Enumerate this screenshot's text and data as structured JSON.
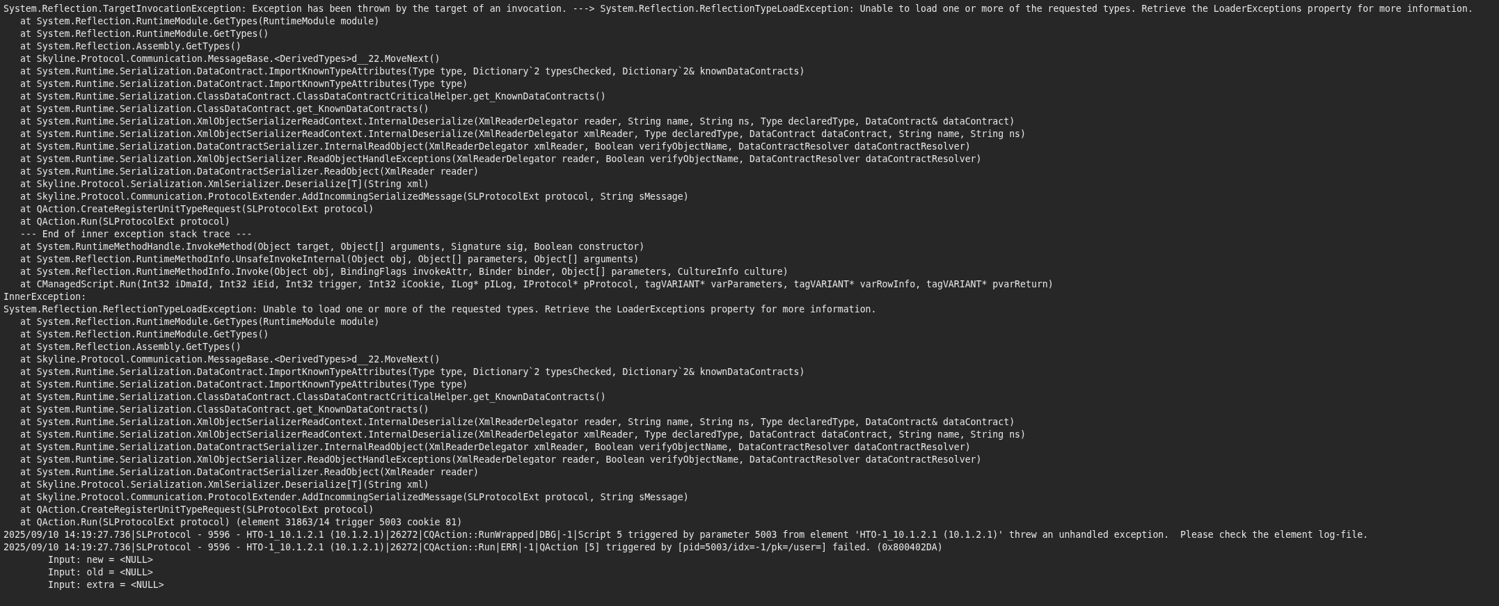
{
  "log_lines": [
    {
      "kind": "message",
      "text": "System.Reflection.TargetInvocationException: Exception has been thrown by the target of an invocation. ---> System.Reflection.ReflectionTypeLoadException: Unable to load one or more of the requested types. Retrieve the LoaderExceptions property for more information."
    },
    {
      "kind": "frame",
      "text": "at System.Reflection.RuntimeModule.GetTypes(RuntimeModule module)"
    },
    {
      "kind": "frame",
      "text": "at System.Reflection.RuntimeModule.GetTypes()"
    },
    {
      "kind": "frame",
      "text": "at System.Reflection.Assembly.GetTypes()"
    },
    {
      "kind": "frame",
      "text": "at Skyline.Protocol.Communication.MessageBase.<DerivedTypes>d__22.MoveNext()"
    },
    {
      "kind": "frame",
      "text": "at System.Runtime.Serialization.DataContract.ImportKnownTypeAttributes(Type type, Dictionary`2 typesChecked, Dictionary`2& knownDataContracts)"
    },
    {
      "kind": "frame",
      "text": "at System.Runtime.Serialization.DataContract.ImportKnownTypeAttributes(Type type)"
    },
    {
      "kind": "frame",
      "text": "at System.Runtime.Serialization.ClassDataContract.ClassDataContractCriticalHelper.get_KnownDataContracts()"
    },
    {
      "kind": "frame",
      "text": "at System.Runtime.Serialization.ClassDataContract.get_KnownDataContracts()"
    },
    {
      "kind": "frame",
      "text": "at System.Runtime.Serialization.XmlObjectSerializerReadContext.InternalDeserialize(XmlReaderDelegator reader, String name, String ns, Type declaredType, DataContract& dataContract)"
    },
    {
      "kind": "frame",
      "text": "at System.Runtime.Serialization.XmlObjectSerializerReadContext.InternalDeserialize(XmlReaderDelegator xmlReader, Type declaredType, DataContract dataContract, String name, String ns)"
    },
    {
      "kind": "frame",
      "text": "at System.Runtime.Serialization.DataContractSerializer.InternalReadObject(XmlReaderDelegator xmlReader, Boolean verifyObjectName, DataContractResolver dataContractResolver)"
    },
    {
      "kind": "frame",
      "text": "at System.Runtime.Serialization.XmlObjectSerializer.ReadObjectHandleExceptions(XmlReaderDelegator reader, Boolean verifyObjectName, DataContractResolver dataContractResolver)"
    },
    {
      "kind": "frame",
      "text": "at System.Runtime.Serialization.DataContractSerializer.ReadObject(XmlReader reader)"
    },
    {
      "kind": "frame",
      "text": "at Skyline.Protocol.Serialization.XmlSerializer.Deserialize[T](String xml)"
    },
    {
      "kind": "frame",
      "text": "at Skyline.Protocol.Communication.ProtocolExtender.AddIncommingSerializedMessage(SLProtocolExt protocol, String sMessage)"
    },
    {
      "kind": "frame",
      "text": "at QAction.CreateRegisterUnitTypeRequest(SLProtocolExt protocol)"
    },
    {
      "kind": "frame",
      "text": "at QAction.Run(SLProtocolExt protocol)"
    },
    {
      "kind": "frame",
      "text": "--- End of inner exception stack trace ---"
    },
    {
      "kind": "frame",
      "text": "at System.RuntimeMethodHandle.InvokeMethod(Object target, Object[] arguments, Signature sig, Boolean constructor)"
    },
    {
      "kind": "frame",
      "text": "at System.Reflection.RuntimeMethodInfo.UnsafeInvokeInternal(Object obj, Object[] parameters, Object[] arguments)"
    },
    {
      "kind": "frame",
      "text": "at System.Reflection.RuntimeMethodInfo.Invoke(Object obj, BindingFlags invokeAttr, Binder binder, Object[] parameters, CultureInfo culture)"
    },
    {
      "kind": "frame",
      "text": "at CManagedScript.Run(Int32 iDmaId, Int32 iEid, Int32 trigger, Int32 iCookie, ILog* pILog, IProtocol* pProtocol, tagVARIANT* varParameters, tagVARIANT* varRowInfo, tagVARIANT* pvarReturn)"
    },
    {
      "kind": "message",
      "text": "InnerException:"
    },
    {
      "kind": "message",
      "text": "System.Reflection.ReflectionTypeLoadException: Unable to load one or more of the requested types. Retrieve the LoaderExceptions property for more information."
    },
    {
      "kind": "frame",
      "text": "at System.Reflection.RuntimeModule.GetTypes(RuntimeModule module)"
    },
    {
      "kind": "frame",
      "text": "at System.Reflection.RuntimeModule.GetTypes()"
    },
    {
      "kind": "frame",
      "text": "at System.Reflection.Assembly.GetTypes()"
    },
    {
      "kind": "frame",
      "text": "at Skyline.Protocol.Communication.MessageBase.<DerivedTypes>d__22.MoveNext()"
    },
    {
      "kind": "frame",
      "text": "at System.Runtime.Serialization.DataContract.ImportKnownTypeAttributes(Type type, Dictionary`2 typesChecked, Dictionary`2& knownDataContracts)"
    },
    {
      "kind": "frame",
      "text": "at System.Runtime.Serialization.DataContract.ImportKnownTypeAttributes(Type type)"
    },
    {
      "kind": "frame",
      "text": "at System.Runtime.Serialization.ClassDataContract.ClassDataContractCriticalHelper.get_KnownDataContracts()"
    },
    {
      "kind": "frame",
      "text": "at System.Runtime.Serialization.ClassDataContract.get_KnownDataContracts()"
    },
    {
      "kind": "frame",
      "text": "at System.Runtime.Serialization.XmlObjectSerializerReadContext.InternalDeserialize(XmlReaderDelegator reader, String name, String ns, Type declaredType, DataContract& dataContract)"
    },
    {
      "kind": "frame",
      "text": "at System.Runtime.Serialization.XmlObjectSerializerReadContext.InternalDeserialize(XmlReaderDelegator xmlReader, Type declaredType, DataContract dataContract, String name, String ns)"
    },
    {
      "kind": "frame",
      "text": "at System.Runtime.Serialization.DataContractSerializer.InternalReadObject(XmlReaderDelegator xmlReader, Boolean verifyObjectName, DataContractResolver dataContractResolver)"
    },
    {
      "kind": "frame",
      "text": "at System.Runtime.Serialization.XmlObjectSerializer.ReadObjectHandleExceptions(XmlReaderDelegator reader, Boolean verifyObjectName, DataContractResolver dataContractResolver)"
    },
    {
      "kind": "frame",
      "text": "at System.Runtime.Serialization.DataContractSerializer.ReadObject(XmlReader reader)"
    },
    {
      "kind": "frame",
      "text": "at Skyline.Protocol.Serialization.XmlSerializer.Deserialize[T](String xml)"
    },
    {
      "kind": "frame",
      "text": "at Skyline.Protocol.Communication.ProtocolExtender.AddIncommingSerializedMessage(SLProtocolExt protocol, String sMessage)"
    },
    {
      "kind": "frame",
      "text": "at QAction.CreateRegisterUnitTypeRequest(SLProtocolExt protocol)"
    },
    {
      "kind": "frame",
      "text": "at QAction.Run(SLProtocolExt protocol) (element 31863/14 trigger 5003 cookie 81)"
    },
    {
      "kind": "message",
      "text": "2025/09/10 14:19:27.736|SLProtocol - 9596 - HTO-1_10.1.2.1 (10.1.2.1)|26272|CQAction::RunWrapped|DBG|-1|Script 5 triggered by parameter 5003 from element 'HTO-1_10.1.2.1 (10.1.2.1)' threw an unhandled exception.  Please check the element log-file."
    },
    {
      "kind": "message",
      "text": "2025/09/10 14:19:27.736|SLProtocol - 9596 - HTO-1_10.1.2.1 (10.1.2.1)|26272|CQAction::Run|ERR|-1|QAction [5] triggered by [pid=5003/idx=-1/pk=/user=] failed. (0x800402DA)"
    },
    {
      "kind": "input",
      "text": "Input: new = <NULL>"
    },
    {
      "kind": "input",
      "text": "Input: old = <NULL>"
    },
    {
      "kind": "input",
      "text": "Input: extra = <NULL>"
    }
  ]
}
